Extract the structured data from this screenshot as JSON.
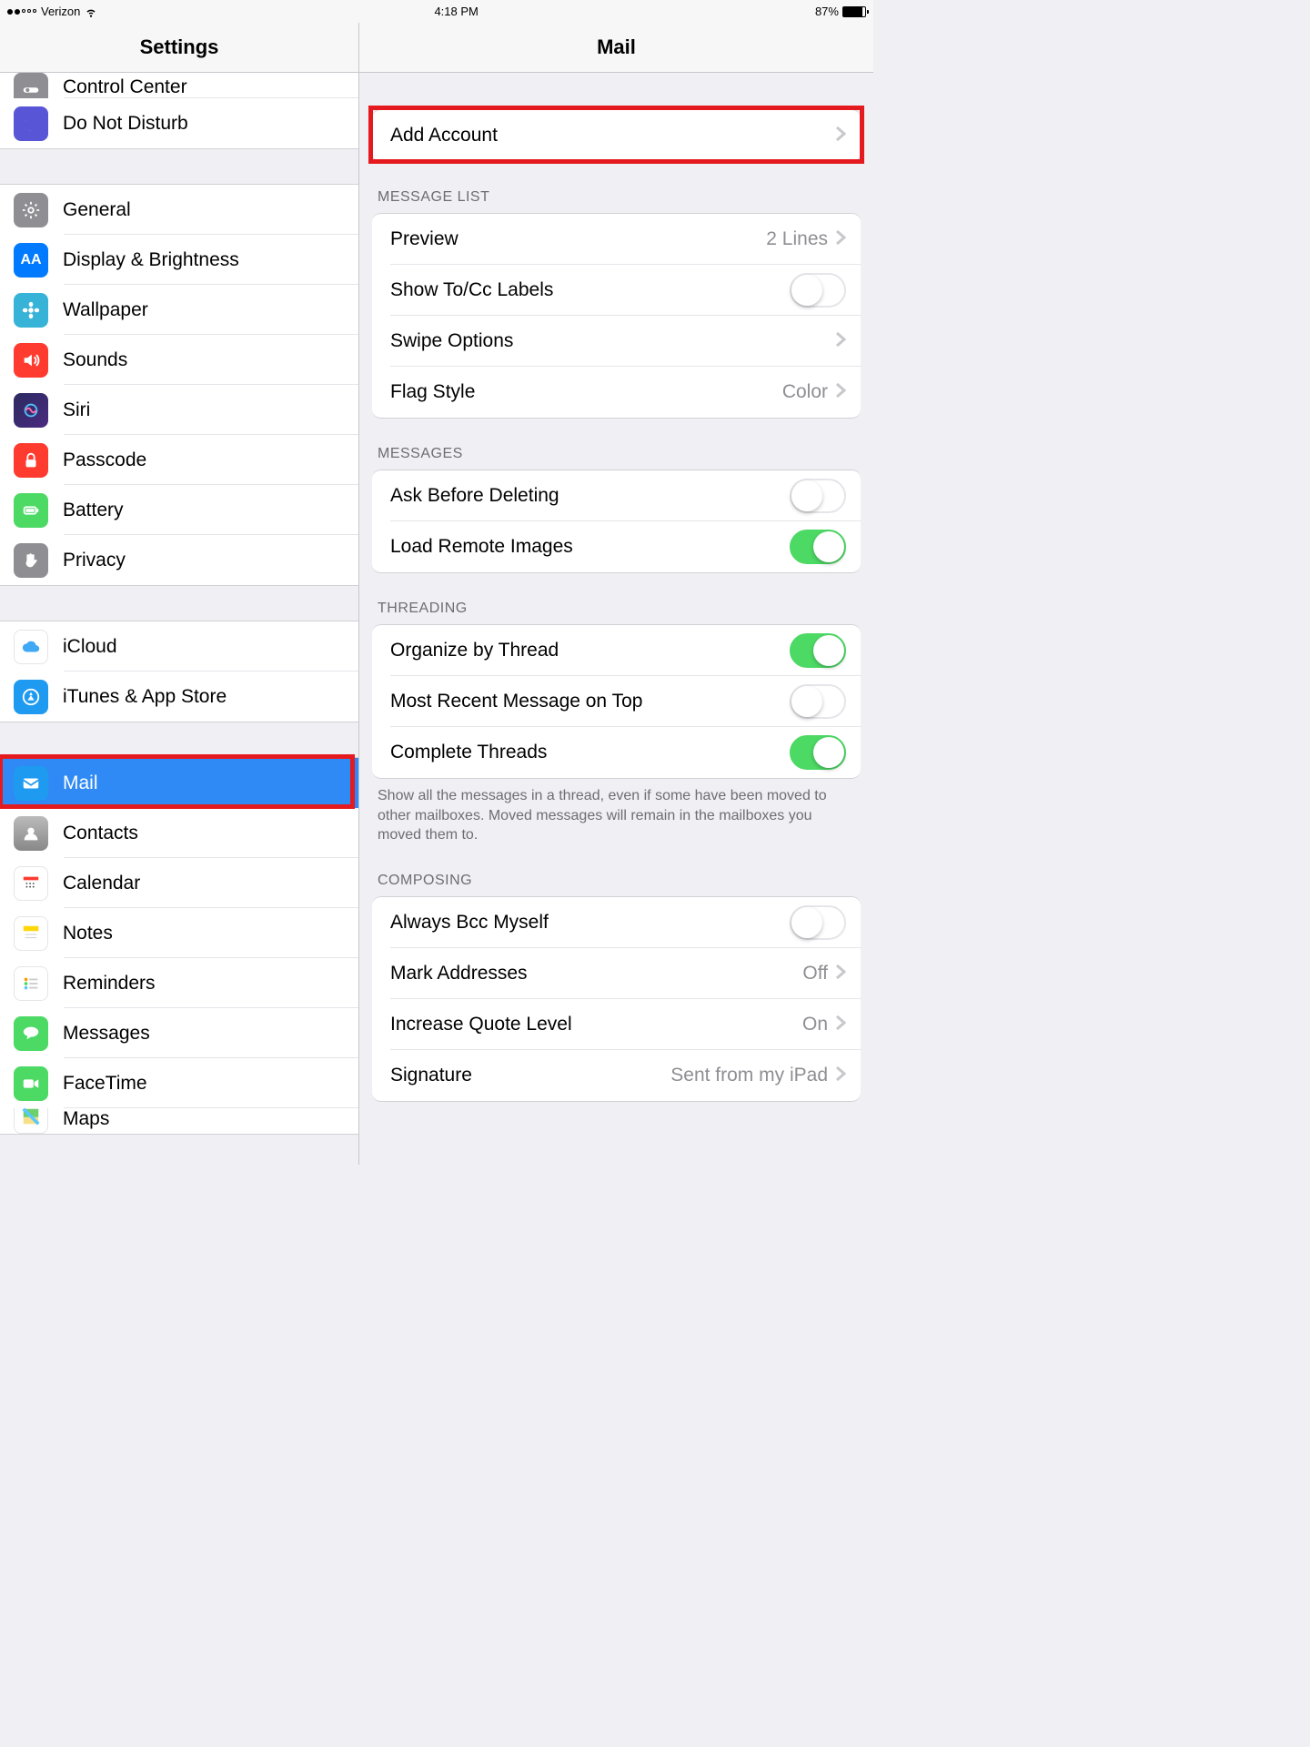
{
  "statusbar": {
    "carrier": "Verizon",
    "time": "4:18 PM",
    "battery_pct": "87%"
  },
  "titles": {
    "left": "Settings",
    "right": "Mail"
  },
  "sidebar": {
    "g1": [
      {
        "label": "Control Center",
        "icon": "control-center-icon",
        "bg": "#8e8e93"
      },
      {
        "label": "Do Not Disturb",
        "icon": "moon-icon",
        "bg": "#5856d6"
      }
    ],
    "g2": [
      {
        "label": "General",
        "icon": "gear-icon",
        "bg": "#8e8e93"
      },
      {
        "label": "Display & Brightness",
        "icon": "aa-icon",
        "bg": "#007aff"
      },
      {
        "label": "Wallpaper",
        "icon": "flower-icon",
        "bg": "#38b3d8"
      },
      {
        "label": "Sounds",
        "icon": "speaker-icon",
        "bg": "#ff3b30"
      },
      {
        "label": "Siri",
        "icon": "siri-icon",
        "bg": "#2b2b50"
      },
      {
        "label": "Passcode",
        "icon": "lock-icon",
        "bg": "#ff3b30"
      },
      {
        "label": "Battery",
        "icon": "battery-icon",
        "bg": "#4cd964"
      },
      {
        "label": "Privacy",
        "icon": "hand-icon",
        "bg": "#8e8e93"
      }
    ],
    "g3": [
      {
        "label": "iCloud",
        "icon": "cloud-icon",
        "bg": "#ffffff"
      },
      {
        "label": "iTunes & App Store",
        "icon": "appstore-icon",
        "bg": "#1e9af1"
      }
    ],
    "g4": [
      {
        "label": "Mail",
        "icon": "mail-icon",
        "bg": "#1e9af1",
        "selected": true
      },
      {
        "label": "Contacts",
        "icon": "contacts-icon",
        "bg": "#8e8e93"
      },
      {
        "label": "Calendar",
        "icon": "calendar-icon",
        "bg": "#ffffff"
      },
      {
        "label": "Notes",
        "icon": "notes-icon",
        "bg": "#ffd60a"
      },
      {
        "label": "Reminders",
        "icon": "reminders-icon",
        "bg": "#ffffff"
      },
      {
        "label": "Messages",
        "icon": "messages-icon",
        "bg": "#4cd964"
      },
      {
        "label": "FaceTime",
        "icon": "facetime-icon",
        "bg": "#4cd964"
      },
      {
        "label": "Maps",
        "icon": "maps-icon",
        "bg": "#ffffff"
      }
    ]
  },
  "detail": {
    "add_account": "Add Account",
    "sections": {
      "message_list": {
        "header": "MESSAGE LIST",
        "preview_label": "Preview",
        "preview_value": "2 Lines",
        "show_tocc_label": "Show To/Cc Labels",
        "swipe_label": "Swipe Options",
        "flag_label": "Flag Style",
        "flag_value": "Color"
      },
      "messages": {
        "header": "MESSAGES",
        "ask_label": "Ask Before Deleting",
        "load_label": "Load Remote Images"
      },
      "threading": {
        "header": "THREADING",
        "organize_label": "Organize by Thread",
        "recent_label": "Most Recent Message on Top",
        "complete_label": "Complete Threads",
        "footer": "Show all the messages in a thread, even if some have been moved to other mailboxes. Moved messages will remain in the mailboxes you moved them to."
      },
      "composing": {
        "header": "COMPOSING",
        "bcc_label": "Always Bcc Myself",
        "mark_label": "Mark Addresses",
        "mark_value": "Off",
        "quote_label": "Increase Quote Level",
        "quote_value": "On",
        "sig_label": "Signature",
        "sig_value": "Sent from my iPad"
      }
    }
  }
}
